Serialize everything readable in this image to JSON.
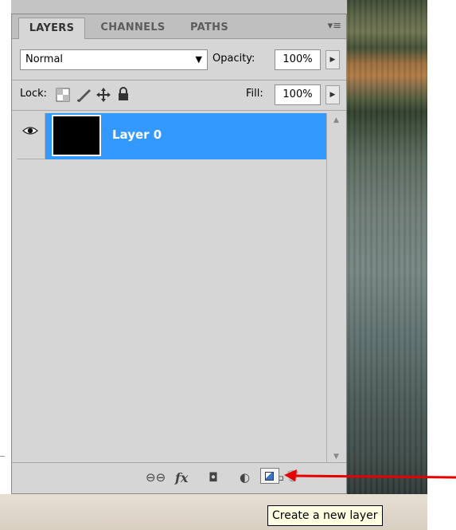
{
  "panel": {
    "tabs": [
      {
        "label": "LAYERS",
        "active": true
      },
      {
        "label": "CHANNELS",
        "active": false
      },
      {
        "label": "PATHS",
        "active": false
      }
    ],
    "menu_glyph": "▾≡"
  },
  "blend": {
    "mode": "Normal",
    "arrow": "▼",
    "opacity_label": "Opacity:",
    "opacity_value": "100%"
  },
  "lock": {
    "label": "Lock:",
    "fill_label": "Fill:",
    "fill_value": "100%"
  },
  "layers": [
    {
      "name": "Layer 0",
      "selected": true,
      "visible": true
    }
  ],
  "footer": {
    "link_glyph": "⊖⊖",
    "fx_label": "fx",
    "mask_glyph": "◘",
    "adjust_glyph": "◐",
    "group_glyph": "▭",
    "trash_glyph": "🗑"
  },
  "tooltip": {
    "text": "Create a new layer"
  },
  "colors": {
    "selection": "#3399ff",
    "arrow": "#e60000",
    "tooltip_bg": "#ffffe1"
  }
}
